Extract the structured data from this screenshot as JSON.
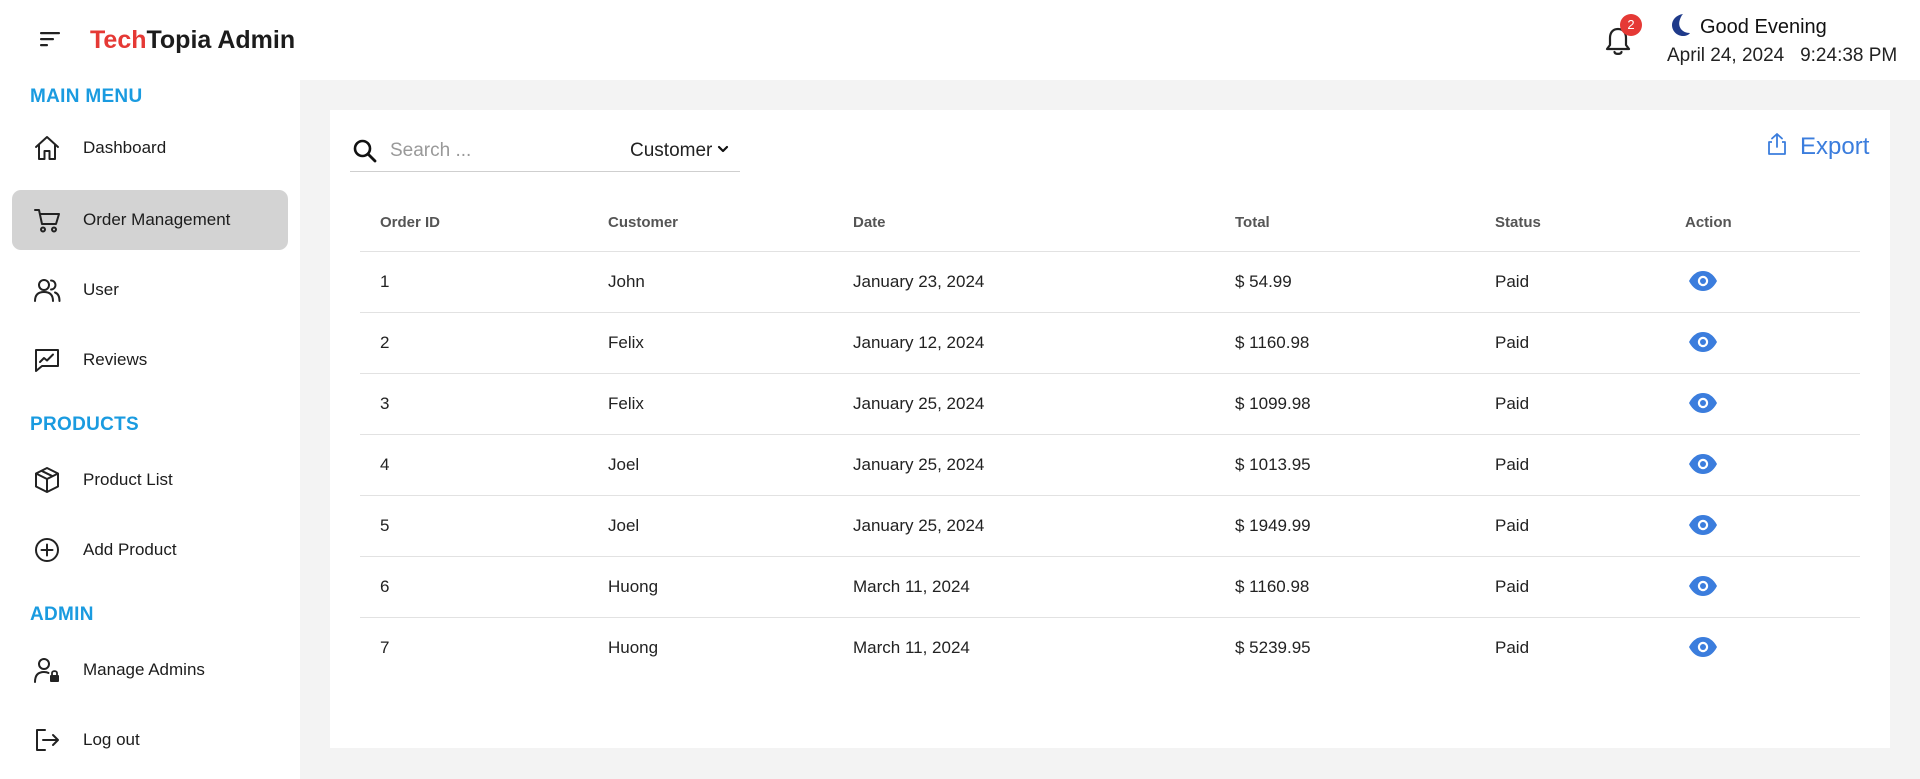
{
  "header": {
    "brand_accent": "Tech",
    "brand_rest": "Topia Admin",
    "notification_count": "2",
    "greeting": "Good Evening",
    "datetime": "April 24, 2024   9:24:38 PM"
  },
  "sidebar": {
    "sections": [
      {
        "title": "MAIN MENU"
      },
      {
        "title": "PRODUCTS"
      },
      {
        "title": "ADMIN"
      }
    ],
    "items": [
      {
        "label": "Dashboard",
        "icon": "home-icon"
      },
      {
        "label": "Order Management",
        "icon": "cart-icon",
        "active": true
      },
      {
        "label": "User",
        "icon": "users-icon"
      },
      {
        "label": "Reviews",
        "icon": "reviews-icon"
      },
      {
        "label": "Product List",
        "icon": "box-icon"
      },
      {
        "label": "Add Product",
        "icon": "plus-circle-icon"
      },
      {
        "label": "Manage Admins",
        "icon": "user-lock-icon"
      },
      {
        "label": "Log out",
        "icon": "logout-icon"
      }
    ]
  },
  "toolbar": {
    "search_placeholder": "Search ...",
    "filter_value": "Customer",
    "export_label": "Export"
  },
  "table": {
    "columns": [
      "Order ID",
      "Customer",
      "Date",
      "Total",
      "Status",
      "Action"
    ],
    "rows": [
      {
        "id": "1",
        "customer": "John",
        "date": "January 23, 2024",
        "total": "$ 54.99",
        "status": "Paid"
      },
      {
        "id": "2",
        "customer": "Felix",
        "date": "January 12, 2024",
        "total": "$ 1160.98",
        "status": "Paid"
      },
      {
        "id": "3",
        "customer": "Felix",
        "date": "January 25, 2024",
        "total": "$ 1099.98",
        "status": "Paid"
      },
      {
        "id": "4",
        "customer": "Joel",
        "date": "January 25, 2024",
        "total": "$ 1013.95",
        "status": "Paid"
      },
      {
        "id": "5",
        "customer": "Joel",
        "date": "January 25, 2024",
        "total": "$ 1949.99",
        "status": "Paid"
      },
      {
        "id": "6",
        "customer": "Huong",
        "date": "March 11, 2024",
        "total": "$ 1160.98",
        "status": "Paid"
      },
      {
        "id": "7",
        "customer": "Huong",
        "date": "March 11, 2024",
        "total": "$ 5239.95",
        "status": "Paid"
      }
    ]
  },
  "colors": {
    "brand_accent": "#e53935",
    "section_title": "#1a9be0",
    "link_blue": "#3b7ddd",
    "active_item_bg": "#d3d3d3",
    "moon": "#1f3a8a"
  }
}
